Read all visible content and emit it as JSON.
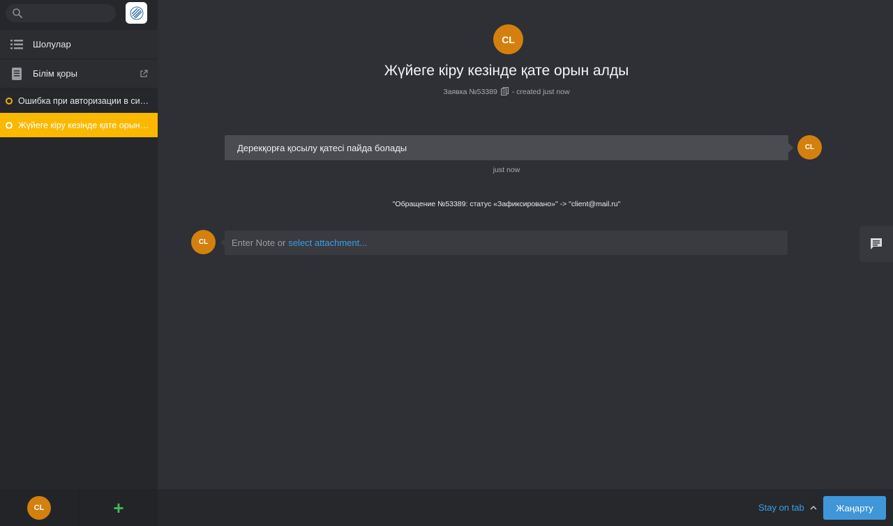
{
  "sidebar": {
    "search": {
      "placeholder": ""
    },
    "nav": [
      {
        "label": "Шолулар",
        "icon": "list-icon"
      },
      {
        "label": "Білім қоры",
        "icon": "book-icon"
      }
    ],
    "tickets": [
      {
        "label": "Ошибка при авторизации в системе"
      },
      {
        "label": "Жүйеге кіру кезінде қате орын алды"
      }
    ],
    "footer": {
      "avatar_initials": "CL",
      "add_label": "+"
    }
  },
  "ticket": {
    "avatar_initials": "CL",
    "title": "Жүйеге кіру кезінде қате орын алды",
    "number": "Заявка №53389",
    "created": "- created just now"
  },
  "article": {
    "text": "Дерекқорға қосылу қатесі пайда болады",
    "avatar_initials": "CL",
    "time": "just now"
  },
  "system_message": "\"Обращение №53389: статус «Зафиксировано»\" -> \"client@mail.ru\"",
  "note": {
    "avatar_initials": "CL",
    "placeholder": "Enter Note or",
    "attach_label": "select attachment..."
  },
  "bottom_bar": {
    "stay_on_tab": "Stay on tab",
    "update_button": "Жаңарту"
  },
  "colors": {
    "accent": "#fbb800",
    "avatar": "#d4800f",
    "link": "#3b9ee8",
    "button": "#3f96d8",
    "add": "#3fba58"
  }
}
